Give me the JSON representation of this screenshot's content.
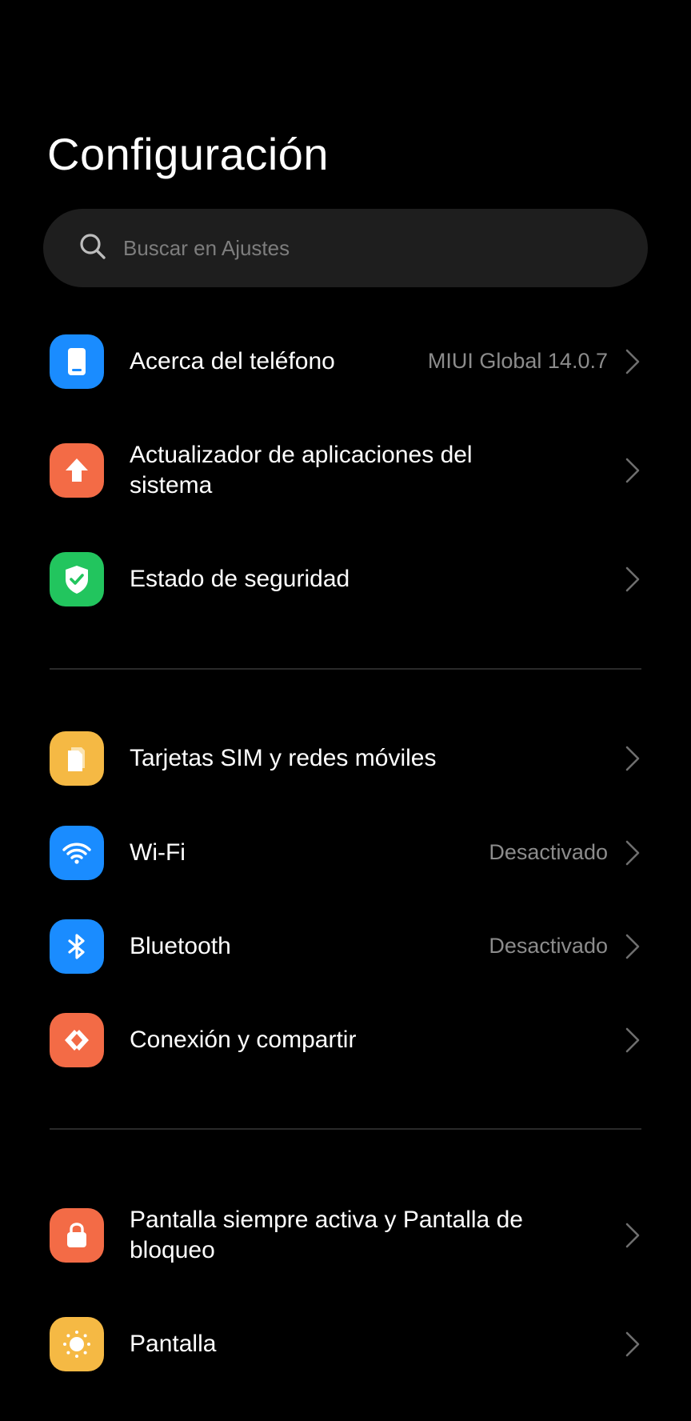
{
  "header": {
    "title": "Configuración"
  },
  "search": {
    "placeholder": "Buscar en Ajustes",
    "icon": "search-icon"
  },
  "settings": {
    "about": {
      "label": "Acerca del teléfono",
      "value": "MIUI Global 14.0.7",
      "icon": "phone-icon",
      "color": "#1a8cff"
    },
    "updater": {
      "label": "Actualizador de aplicaciones del sistema",
      "icon": "upload-arrow-icon",
      "color": "#f36b46"
    },
    "security": {
      "label": "Estado de seguridad",
      "icon": "shield-check-icon",
      "color": "#22c55e"
    },
    "sim": {
      "label": "Tarjetas SIM y redes móviles",
      "icon": "sim-card-icon",
      "color": "#f5b944"
    },
    "wifi": {
      "label": "Wi-Fi",
      "value": "Desactivado",
      "icon": "wifi-icon",
      "color": "#1a8cff"
    },
    "bluetooth": {
      "label": "Bluetooth",
      "value": "Desactivado",
      "icon": "bluetooth-icon",
      "color": "#1a8cff"
    },
    "connection": {
      "label": "Conexión y compartir",
      "icon": "connection-share-icon",
      "color": "#f36b46"
    },
    "lockscreen": {
      "label": "Pantalla siempre activa y Pantalla de bloqueo",
      "icon": "lock-icon",
      "color": "#f36b46"
    },
    "display": {
      "label": "Pantalla",
      "icon": "sun-icon",
      "color": "#f5b944"
    }
  }
}
